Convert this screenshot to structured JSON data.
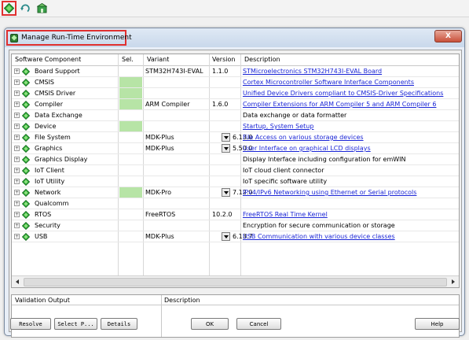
{
  "toolbar": {
    "buttons": [
      {
        "icon": "green-diamond-icon",
        "highlighted": true
      },
      {
        "icon": "refresh-icon",
        "highlighted": false
      },
      {
        "icon": "pack-installer-icon",
        "highlighted": false
      }
    ]
  },
  "dialog": {
    "title": "Manage Run-Time Environment",
    "close_label": "X"
  },
  "table": {
    "headers": {
      "component": "Software Component",
      "sel": "Sel.",
      "variant": "Variant",
      "version": "Version",
      "description": "Description"
    },
    "rows": [
      {
        "name": "Board Support",
        "selected": false,
        "variant": "STM32H743I-EVAL",
        "has_dropdown": false,
        "version": "1.1.0",
        "description": "STMicroelectronics STM32H743I-EVAL Board",
        "link": true
      },
      {
        "name": "CMSIS",
        "selected": true,
        "variant": "",
        "has_dropdown": false,
        "version": "",
        "description": "Cortex Microcontroller Software Interface Components",
        "link": true
      },
      {
        "name": "CMSIS Driver",
        "selected": true,
        "variant": "",
        "has_dropdown": false,
        "version": "",
        "description": "Unified Device Drivers compliant to CMSIS-Driver Specifications",
        "link": true
      },
      {
        "name": "Compiler",
        "selected": true,
        "variant": "ARM Compiler",
        "has_dropdown": false,
        "version": "1.6.0",
        "description": "Compiler Extensions for ARM Compiler 5 and ARM Compiler 6",
        "link": true
      },
      {
        "name": "Data Exchange",
        "selected": false,
        "variant": "",
        "has_dropdown": false,
        "version": "",
        "description": "Data exchange or data formatter",
        "link": false
      },
      {
        "name": "Device",
        "selected": true,
        "variant": "",
        "has_dropdown": false,
        "version": "",
        "description": "Startup, System Setup",
        "link": true
      },
      {
        "name": "File System",
        "selected": false,
        "variant": "MDK-Plus",
        "has_dropdown": true,
        "version": "6.13.0",
        "description": "File Access on various storage devices",
        "link": true
      },
      {
        "name": "Graphics",
        "selected": false,
        "variant": "MDK-Plus",
        "has_dropdown": true,
        "version": "5.50.0",
        "description": "User Interface on graphical LCD displays",
        "link": true
      },
      {
        "name": "Graphics Display",
        "selected": false,
        "variant": "",
        "has_dropdown": false,
        "version": "",
        "description": "Display Interface including configuration for emWIN",
        "link": false
      },
      {
        "name": "IoT Client",
        "selected": false,
        "variant": "",
        "has_dropdown": false,
        "version": "",
        "description": "IoT cloud client connector",
        "link": false
      },
      {
        "name": "IoT Utility",
        "selected": false,
        "variant": "",
        "has_dropdown": false,
        "version": "",
        "description": "IoT specific software utility",
        "link": false
      },
      {
        "name": "Network",
        "selected": true,
        "variant": "MDK-Pro",
        "has_dropdown": true,
        "version": "7.12.0",
        "description": "IPv4/IPv6 Networking using Ethernet or Serial protocols",
        "link": true
      },
      {
        "name": "Qualcomm",
        "selected": false,
        "variant": "",
        "has_dropdown": false,
        "version": "",
        "description": "",
        "link": false
      },
      {
        "name": "RTOS",
        "selected": false,
        "variant": "FreeRTOS",
        "has_dropdown": false,
        "version": "10.2.0",
        "description": "FreeRTOS Real Time Kernel",
        "link": true
      },
      {
        "name": "Security",
        "selected": false,
        "variant": "",
        "has_dropdown": false,
        "version": "",
        "description": "Encryption for secure communication or storage",
        "link": false
      },
      {
        "name": "USB",
        "selected": false,
        "variant": "MDK-Plus",
        "has_dropdown": true,
        "version": "6.13.7",
        "description": "USB Communication with various device classes",
        "link": true
      }
    ]
  },
  "validation": {
    "output_header": "Validation Output",
    "description_header": "Description"
  },
  "buttons": {
    "resolve": "Resolve",
    "select_packs": "Select P...",
    "details": "Details",
    "ok": "OK",
    "cancel": "Cancel",
    "help": "Help"
  },
  "colors": {
    "selected_cell": "#b7e4a6",
    "link": "#1a25d6",
    "highlight_frame": "#e03030"
  }
}
